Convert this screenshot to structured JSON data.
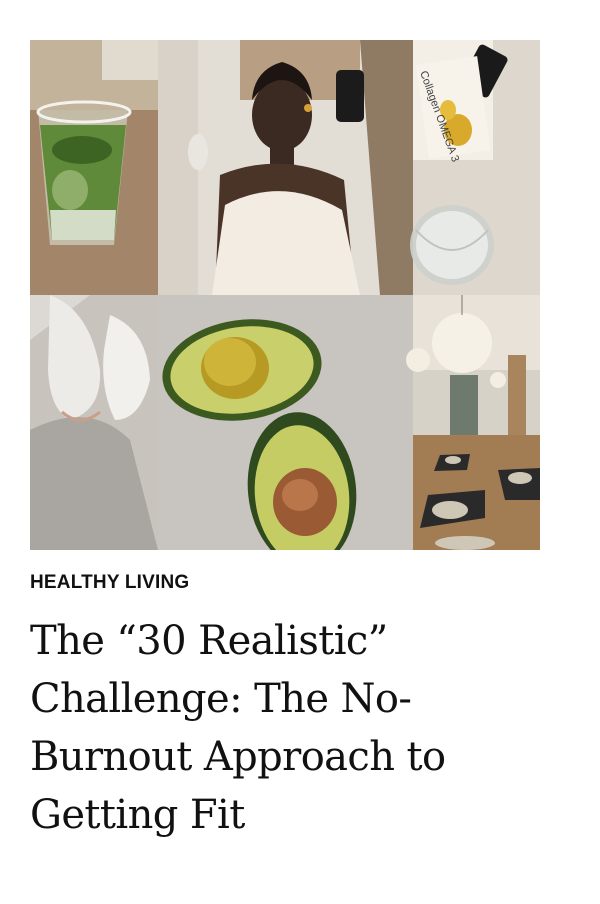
{
  "article": {
    "category": "HEALTHY LIVING",
    "headline": "The “30 Realistic” Challenge: The No-Burnout Approach to Getting Fit"
  },
  "collage": {
    "bottle_label": "Collagen OMEGA 3",
    "accent": "#2f4a1e"
  }
}
